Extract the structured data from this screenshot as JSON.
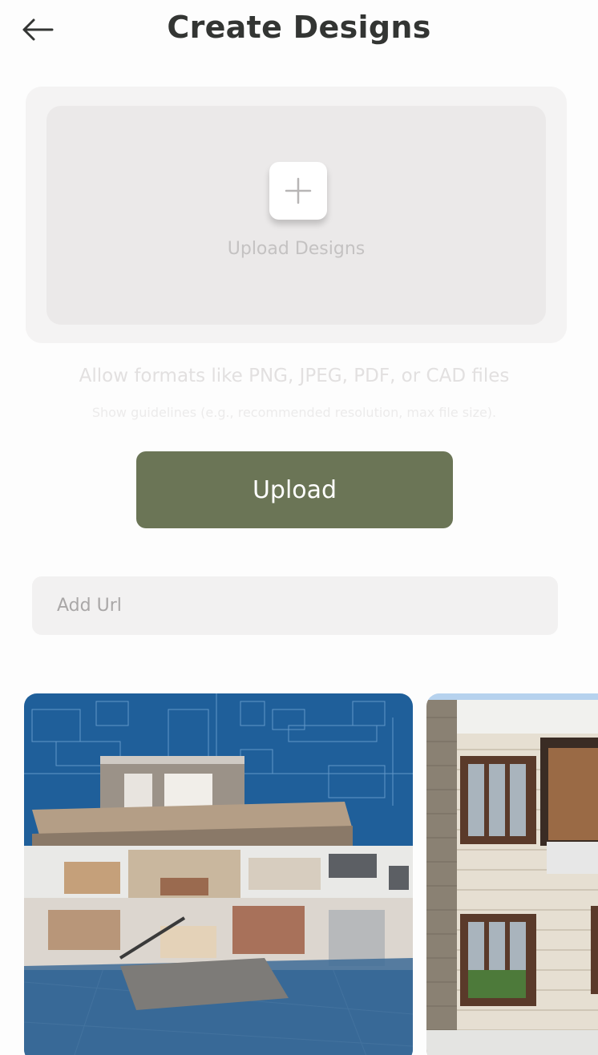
{
  "header": {
    "title": "Create Designs",
    "back_icon": "arrow-left-icon"
  },
  "upload_card": {
    "plus_icon": "plus-icon",
    "label": "Upload Designs"
  },
  "hints": {
    "formats": "Allow formats like PNG, JPEG, PDF, or CAD files",
    "guidelines": "Show guidelines (e.g., recommended resolution, max file size)."
  },
  "upload_button": {
    "label": "Upload"
  },
  "url_field": {
    "value": "",
    "placeholder": "Add Url"
  },
  "gallery": {
    "items": [
      {
        "icon": "house-cutaway-image"
      },
      {
        "icon": "house-facade-image"
      }
    ]
  },
  "colors": {
    "accent": "#6b7556",
    "title": "#333533",
    "blueprint": "#1f5f9a"
  }
}
